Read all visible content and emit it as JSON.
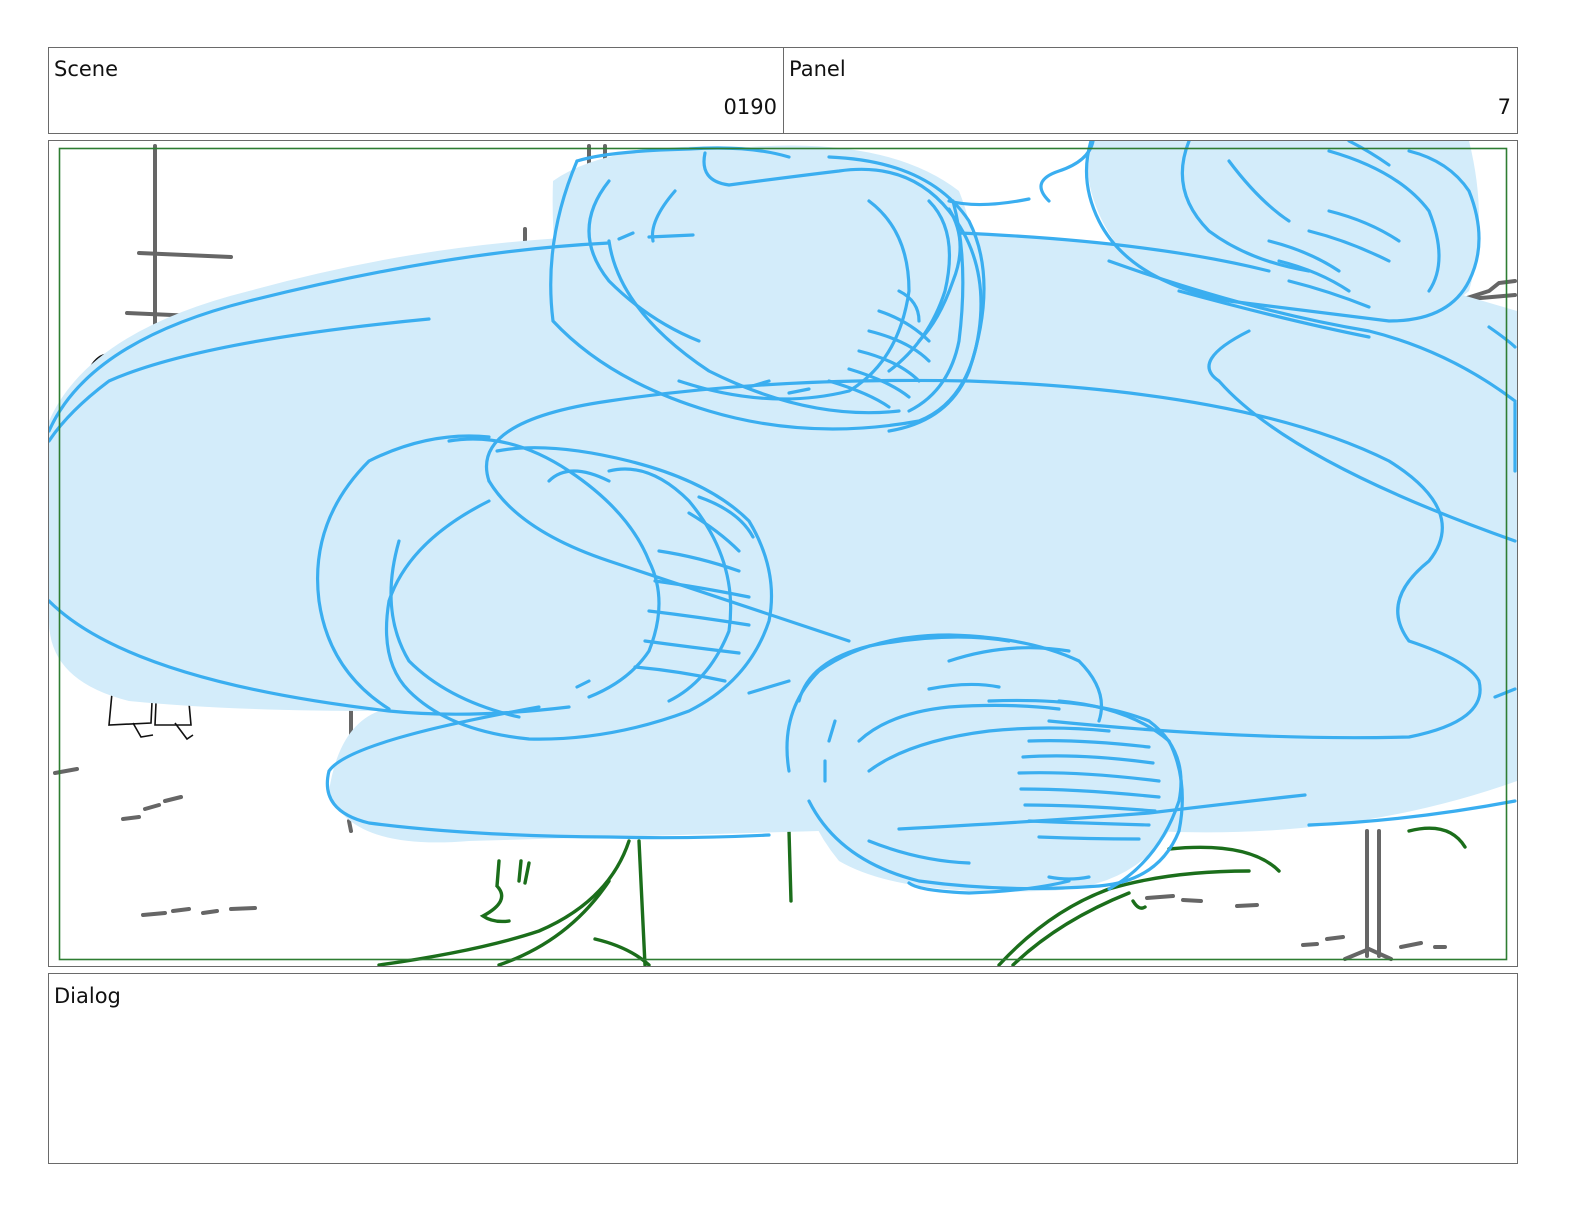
{
  "scene": {
    "label": "Scene",
    "number": "0190"
  },
  "panel": {
    "label": "Panel",
    "number": "7"
  },
  "dialog": {
    "label": "Dialog",
    "text": ""
  },
  "drawing": {
    "description_colors": {
      "cloud_fill": "#d3ecfa",
      "cloud_stroke": "#3aaef0",
      "safe_frame": "#2e7d32",
      "grass": "#1b6e1b",
      "sketch_gray": "#666666"
    }
  }
}
